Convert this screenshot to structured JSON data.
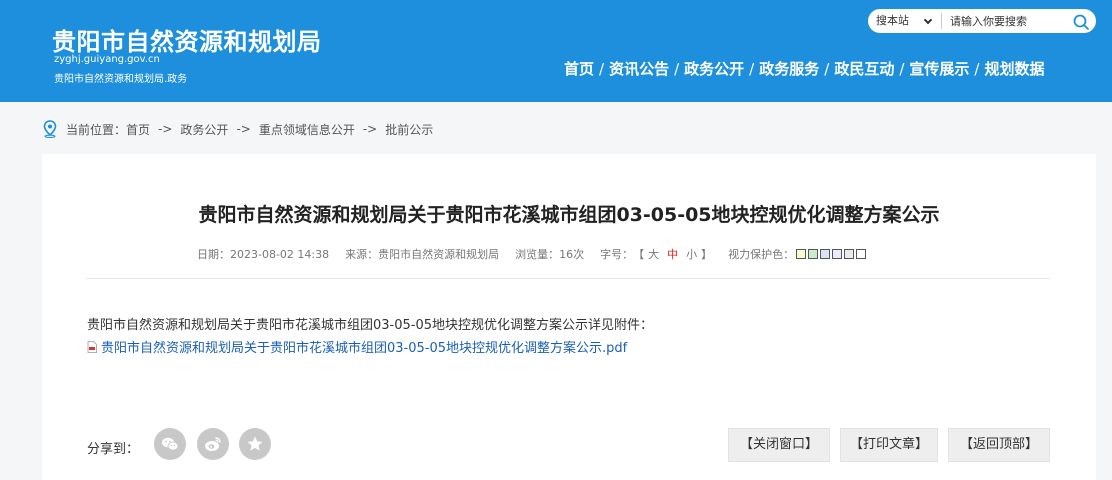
{
  "header": {
    "site_title": "贵阳市自然资源和规划局",
    "domain": "zyghj.guiyang.gov.cn",
    "subtitle": "贵阳市自然资源和规划局.政务",
    "bg_color": "#1d8fdc"
  },
  "search": {
    "select_value": "搜本站",
    "placeholder": "请输入你要搜索"
  },
  "nav": {
    "items": [
      "首页",
      "资讯公告",
      "政务公开",
      "政务服务",
      "政民互动",
      "宣传展示",
      "规划数据"
    ],
    "separator": "/"
  },
  "breadcrumb": {
    "prefix": "当前位置：",
    "items": [
      "首页",
      "政务公开",
      "重点领域信息公开",
      "批前公示"
    ],
    "arrow": "->"
  },
  "article": {
    "title": "贵阳市自然资源和规划局关于贵阳市花溪城市组团03-05-05地块控规优化调整方案公示",
    "date_label": "日期：",
    "date": "2023-08-02 14:38",
    "source_label": "来源：",
    "source": "贵阳市自然资源和规划局",
    "views_label": "浏览量：",
    "views": "16次",
    "fontsize_label": "字号：",
    "fontsize_open": "【",
    "fontsize_large": "大",
    "fontsize_medium": "中",
    "fontsize_small": "小",
    "fontsize_close": "】",
    "eye_care_label": "视力保护色：",
    "eye_care_colors": [
      "#fafad2",
      "#c7edcc",
      "#dce2f1",
      "#e9ebfe",
      "#eaeaef",
      "#ffffff"
    ],
    "body": "贵阳市自然资源和规划局关于贵阳市花溪城市组团03-05-05地块控规优化调整方案公示详见附件：",
    "attachment": "贵阳市自然资源和规划局关于贵阳市花溪城市组团03-05-05地块控规优化调整方案公示.pdf"
  },
  "share": {
    "label": "分享到：",
    "icons": [
      "wechat-icon",
      "weibo-icon",
      "star-icon"
    ]
  },
  "actions": {
    "close": "【关闭窗口】",
    "print": "【打印文章】",
    "back_top": "【返回顶部】"
  }
}
